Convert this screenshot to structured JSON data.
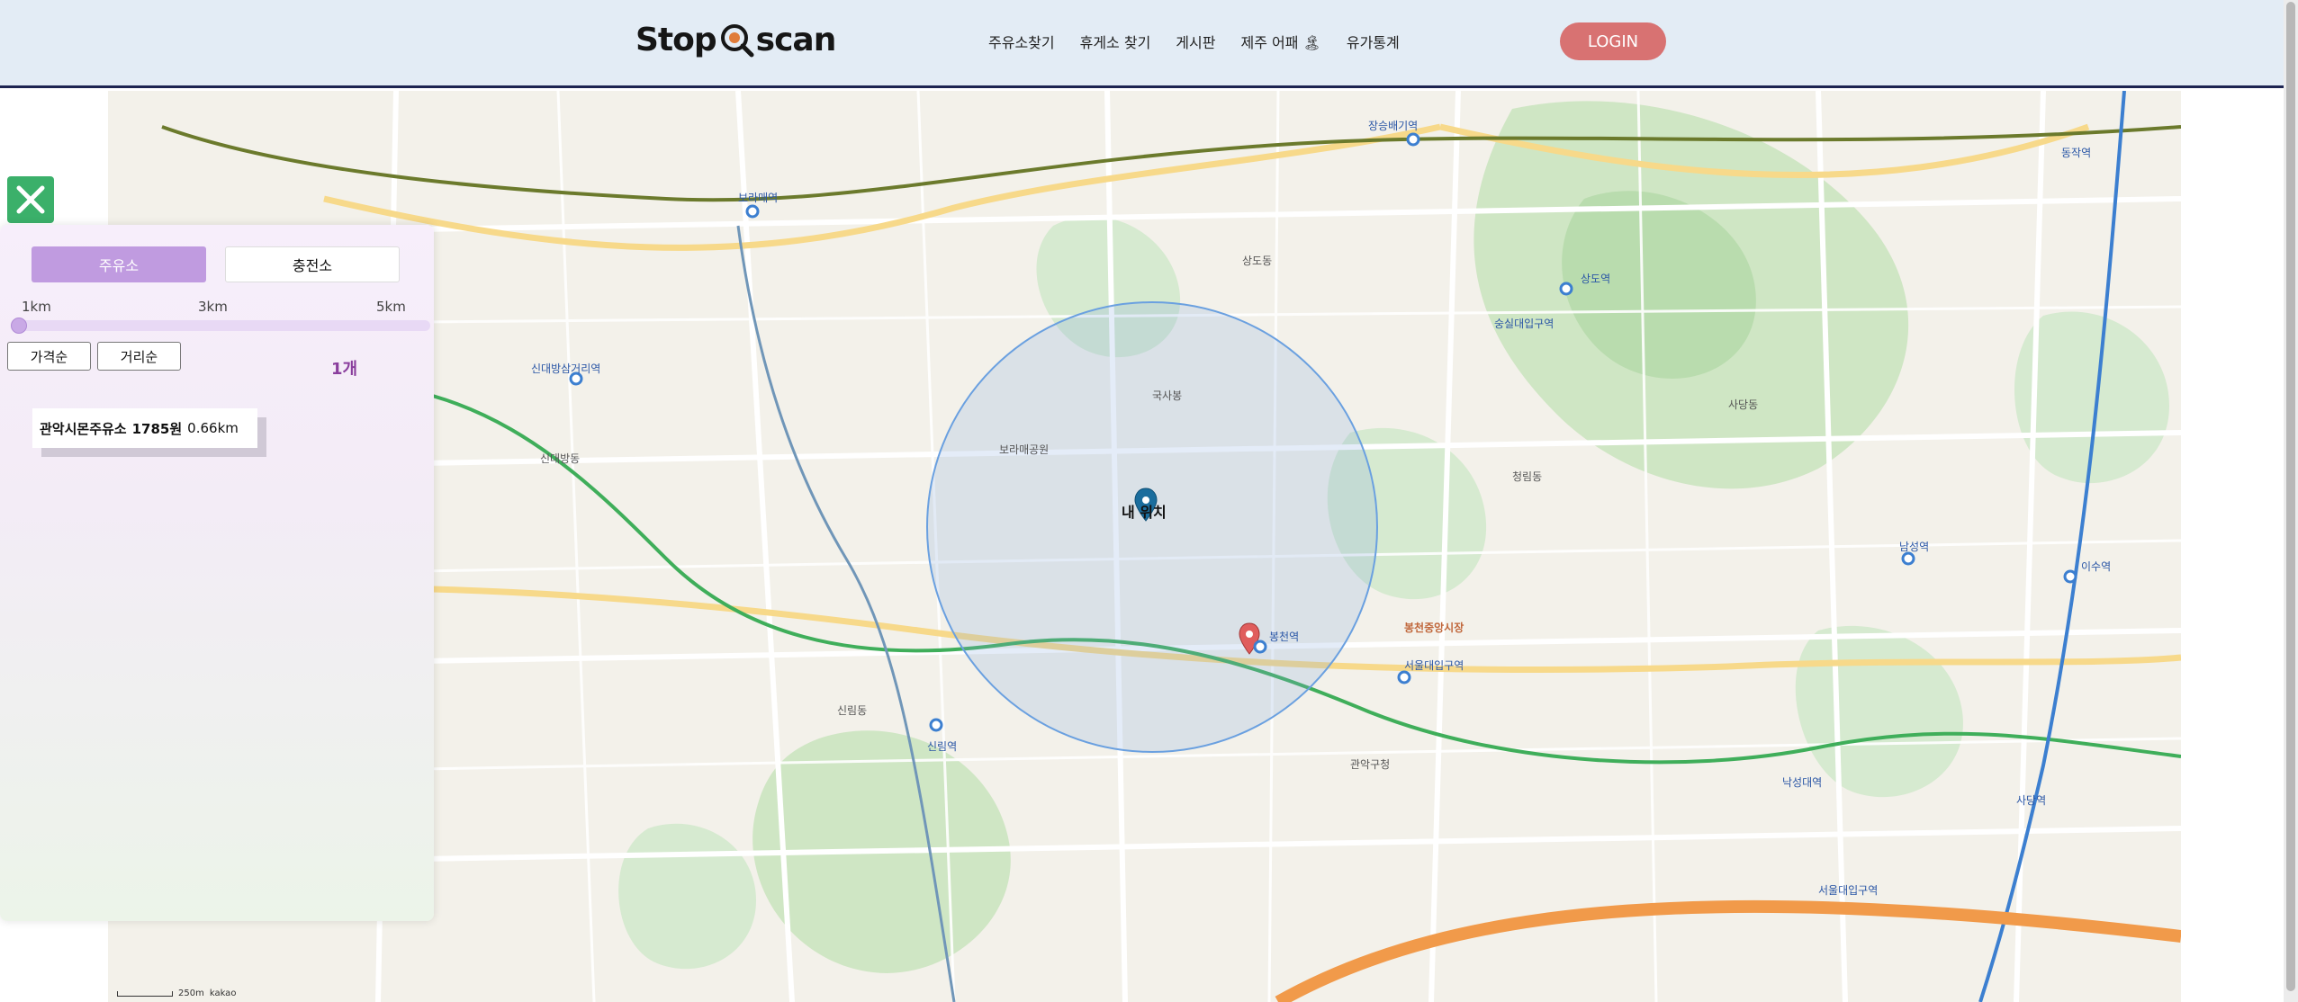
{
  "header": {
    "logo_text": "Stop",
    "logo_text2": "scan",
    "nav": [
      "주유소찾기",
      "휴게소 찾기",
      "게시판",
      "제주 어패 🏝",
      "유가통계"
    ],
    "login_label": "LOGIN"
  },
  "map": {
    "my_location_label": "내 위치",
    "scale_text": "250m",
    "provider": "kakao",
    "labels": [
      {
        "text": "보라매역",
        "kind": "sub"
      },
      {
        "text": "신대방삼거리역",
        "kind": "sub"
      },
      {
        "text": "장승배기역",
        "kind": "sub"
      },
      {
        "text": "상도역",
        "kind": "sub"
      },
      {
        "text": "숭실대입구역",
        "kind": "sub"
      },
      {
        "text": "남성역",
        "kind": "sub"
      },
      {
        "text": "이수역",
        "kind": "sub"
      },
      {
        "text": "사당역",
        "kind": "sub"
      },
      {
        "text": "동작역",
        "kind": "sub"
      },
      {
        "text": "신림역",
        "kind": "sub"
      },
      {
        "text": "봉천역",
        "kind": "sub"
      },
      {
        "text": "서울대입구역",
        "kind": "sub"
      },
      {
        "text": "낙성대역",
        "kind": "sub"
      },
      {
        "text": "보라매공원",
        "kind": "plain"
      },
      {
        "text": "국사봉",
        "kind": "plain"
      },
      {
        "text": "관악구청",
        "kind": "plain"
      },
      {
        "text": "봉천중앙시장",
        "kind": "road"
      },
      {
        "text": "신대방동",
        "kind": "plain"
      },
      {
        "text": "상도동",
        "kind": "plain"
      },
      {
        "text": "사당동",
        "kind": "plain"
      },
      {
        "text": "서울대입구역",
        "kind": "sub"
      },
      {
        "text": "청림동",
        "kind": "plain"
      },
      {
        "text": "신림동",
        "kind": "plain"
      }
    ]
  },
  "panel": {
    "tab_fuel": "주유소",
    "tab_charge": "충전소",
    "dist_min": "1km",
    "dist_mid": "3km",
    "dist_max": "5km",
    "slider_fraction": 0,
    "sort_price": "가격순",
    "sort_distance": "거리순",
    "count": "1개",
    "results": [
      {
        "name": "관악시몬주유소",
        "price": "1785원",
        "distance": "0.66km"
      }
    ]
  },
  "colors": {
    "header_bg": "#e3ecf5",
    "login_bg": "#d87272",
    "tab_active": "#c09be0",
    "close_btn": "#3bb06a",
    "radius_circle": "#6aa0e0",
    "count_text": "#8a3e9d"
  },
  "icons": {
    "close": "close-x-icon",
    "marker_me": "location-pin-icon",
    "marker_station": "gas-station-pin-icon"
  }
}
